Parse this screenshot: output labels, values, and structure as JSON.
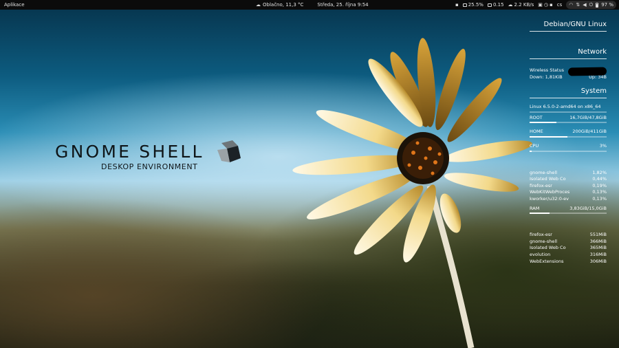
{
  "topbar": {
    "activities": "Aplikace",
    "weather": "Oblačno, 11,3 °C",
    "clock": "Středa, 25. října   9:54",
    "indicators": {
      "cpu": "25.5%",
      "load": "0.15",
      "net": "2.2 KB/s",
      "keyboard": "cs",
      "battery": "97 %"
    }
  },
  "logo": {
    "title": "GNOME SHELL",
    "subtitle": "DESKOP ENVIRONMENT"
  },
  "conky": {
    "distro": "Debian/GNU Linux",
    "network": {
      "heading": "Network",
      "wireless_label": "Wireless Status",
      "down": "Down: 1,81KiB",
      "up": "Up: 34B"
    },
    "system": {
      "heading": "System",
      "kernel": "Linux 6.5.0-2-amd64 on x86_64",
      "root_label": "ROOT",
      "root_value": "16,7GiB/47,8GiB",
      "root_fill": 0.35,
      "home_label": "HOME",
      "home_value": "200GiB/411GiB",
      "home_fill": 0.49,
      "cpu_label": "CPU",
      "cpu_value": "3%",
      "cpu_fill": 0.03
    },
    "cpu_procs": [
      {
        "name": "gnome-shell",
        "value": "1,82%"
      },
      {
        "name": "Isolated Web Co",
        "value": "0,44%"
      },
      {
        "name": "firefox-esr",
        "value": "0,19%"
      },
      {
        "name": "WebKitWebProces",
        "value": "0,13%"
      },
      {
        "name": "kworker/u32:0-ev",
        "value": "0,13%"
      }
    ],
    "ram": {
      "label": "RAM",
      "value": "3,83GiB/15,0GiB",
      "fill": 0.26
    },
    "mem_procs": [
      {
        "name": "firefox-esr",
        "value": "551MiB"
      },
      {
        "name": "gnome-shell",
        "value": "366MiB"
      },
      {
        "name": "Isolated Web Co",
        "value": "365MiB"
      },
      {
        "name": "evolution",
        "value": "316MiB"
      },
      {
        "name": "WebExtensions",
        "value": "306MiB"
      }
    ]
  }
}
